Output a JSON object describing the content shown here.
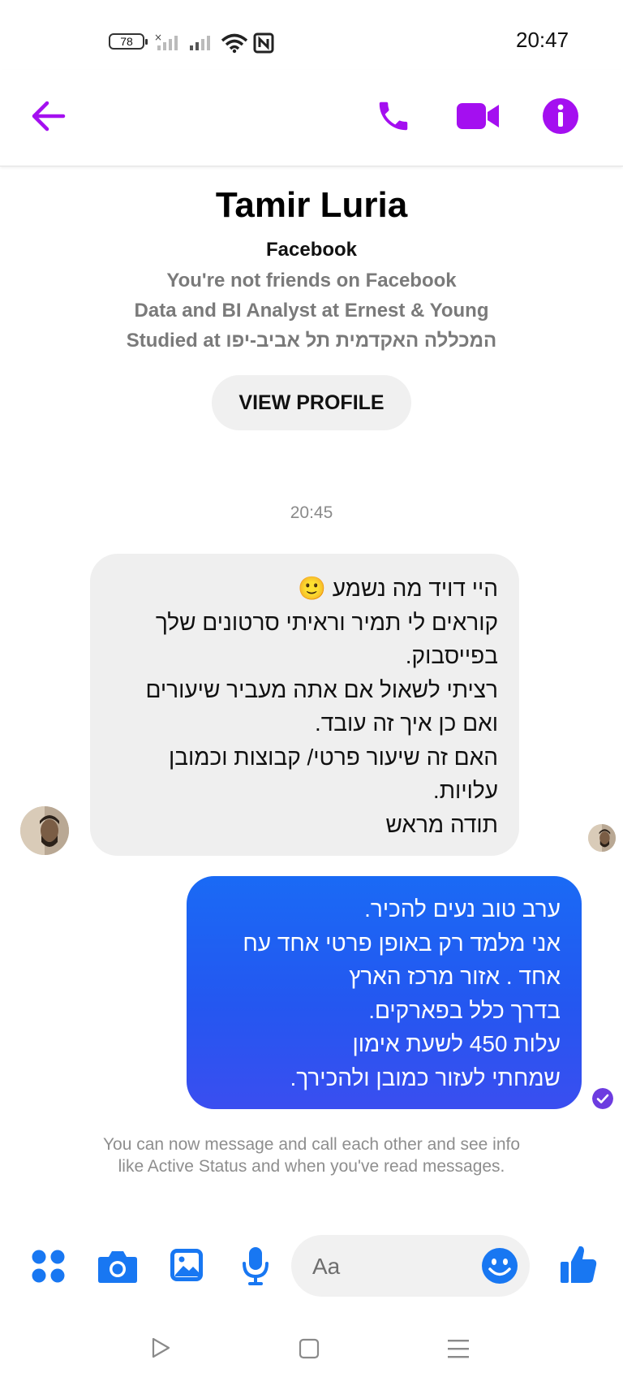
{
  "status_bar": {
    "battery": "78",
    "time": "20:47"
  },
  "header": {
    "back_icon": "arrow-left-icon",
    "call_icon": "phone-icon",
    "video_icon": "video-camera-icon",
    "info_icon": "info-icon",
    "accent_color": "#a40ff0"
  },
  "profile": {
    "name": "Tamir Luria",
    "source": "Facebook",
    "friendship": "You're not friends on Facebook",
    "job": "Data and BI Analyst at Ernest & Young",
    "education": "Studied at המכללה האקדמית תל אביב-יפו",
    "view_profile_label": "VIEW PROFILE"
  },
  "conversation": {
    "timestamp": "20:45",
    "incoming_lines": [
      "היי דויד מה נשמע 🙂",
      "קוראים לי תמיר וראיתי סרטונים שלך",
      "בפייסבוק.",
      "רציתי לשאול אם אתה מעביר שיעורים",
      "ואם כן איך זה עובד.",
      "האם זה שיעור פרטי/ קבוצות וכמובן",
      "עלויות.",
      "תודה מראש"
    ],
    "outgoing_lines": [
      "ערב טוב נעים להכיר.",
      "אני מלמד רק באופן פרטי אחד עח",
      "אחד . אזור מרכז הארץ",
      "בדרך כלל בפארקים.",
      "עלות 450 לשעת אימון",
      "שמחתי לעזור כמובן ולהכירך."
    ],
    "outgoing_color": "#1f5ff2",
    "notice": "You can now message and call each other and see info like Active Status and when you've read messages."
  },
  "composer": {
    "placeholder": "Aa",
    "icons": [
      "apps-icon",
      "camera-icon",
      "gallery-icon",
      "microphone-icon",
      "emoji-icon",
      "thumbs-up-icon"
    ],
    "icon_color": "#1877f2"
  },
  "nav_bar": {
    "icons": [
      "back-triangle-icon",
      "home-square-icon",
      "menu-icon"
    ]
  }
}
